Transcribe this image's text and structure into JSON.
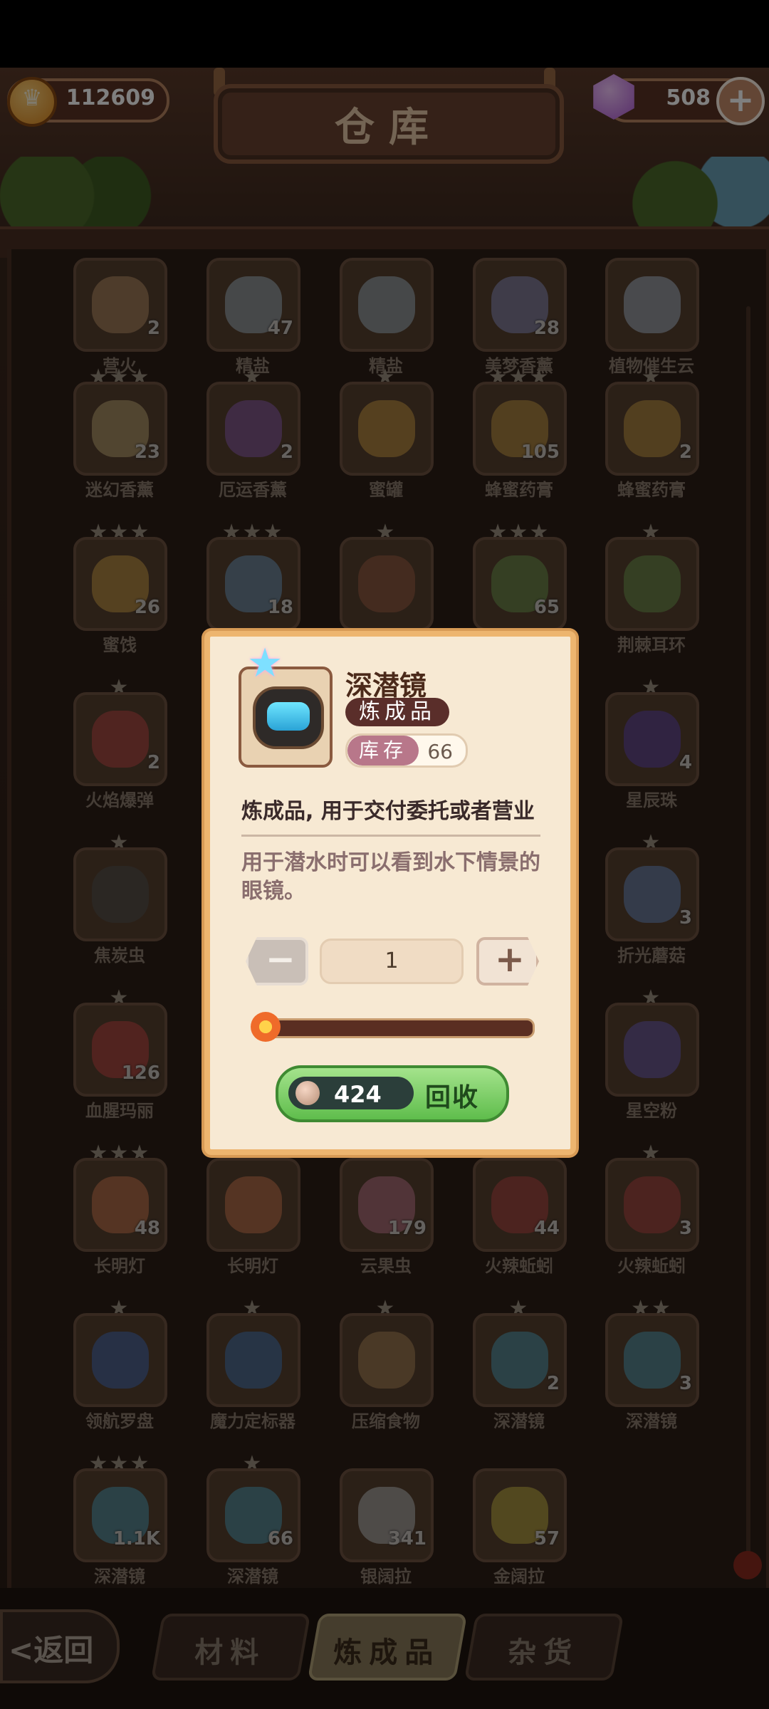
{
  "header": {
    "title": "仓库",
    "coins": "112609",
    "gems": "508"
  },
  "grid": {
    "items": [
      {
        "label": "营火",
        "count": "2",
        "stars": "",
        "color": "#d8a878"
      },
      {
        "label": "精盐",
        "count": "47",
        "stars": "",
        "color": "#bcd2e6"
      },
      {
        "label": "精盐",
        "count": "",
        "stars": "",
        "color": "#bcd2e6"
      },
      {
        "label": "美梦香薰",
        "count": "28",
        "stars": "",
        "color": "#a0a7e6"
      },
      {
        "label": "植物催生云",
        "count": "",
        "stars": "",
        "color": "#c5d9f2"
      },
      {
        "label": "迷幻香薰",
        "count": "23",
        "stars": "★★★",
        "color": "#e2c68a"
      },
      {
        "label": "厄运香薰",
        "count": "2",
        "stars": "★",
        "color": "#a06ad0"
      },
      {
        "label": "蜜罐",
        "count": "",
        "stars": "★",
        "color": "#f0b44a"
      },
      {
        "label": "蜂蜜药膏",
        "count": "105",
        "stars": "★★★",
        "color": "#e8b04a"
      },
      {
        "label": "蜂蜜药膏",
        "count": "2",
        "stars": "★",
        "color": "#e8b04a"
      },
      {
        "label": "蜜饯",
        "count": "26",
        "stars": "★★★",
        "color": "#f0b850"
      },
      {
        "label": "",
        "count": "18",
        "stars": "★★★",
        "color": "#7fb6e6"
      },
      {
        "label": "",
        "count": "",
        "stars": "★",
        "color": "#b56a4a"
      },
      {
        "label": "",
        "count": "65",
        "stars": "★★★",
        "color": "#7cb25a"
      },
      {
        "label": "荆棘耳环",
        "count": "",
        "stars": "★",
        "color": "#7cb25a"
      },
      {
        "label": "火焰爆弹",
        "count": "2",
        "stars": "★",
        "color": "#e05050"
      },
      {
        "label": "",
        "count": "",
        "stars": "",
        "color": "#000000"
      },
      {
        "label": "",
        "count": "",
        "stars": "",
        "color": "#000000"
      },
      {
        "label": "",
        "count": "",
        "stars": "",
        "color": "#000000"
      },
      {
        "label": "星辰珠",
        "count": "4",
        "stars": "★",
        "color": "#6a4ac6"
      },
      {
        "label": "焦炭虫",
        "count": "",
        "stars": "★",
        "color": "#5a5a5a"
      },
      {
        "label": "",
        "count": "",
        "stars": "",
        "color": "#000000"
      },
      {
        "label": "",
        "count": "",
        "stars": "",
        "color": "#000000"
      },
      {
        "label": "",
        "count": "",
        "stars": "",
        "color": "#000000"
      },
      {
        "label": "折光蘑菇",
        "count": "3",
        "stars": "★",
        "color": "#7aa2e8"
      },
      {
        "label": "血腥玛丽",
        "count": "126",
        "stars": "★",
        "color": "#e24a4a"
      },
      {
        "label": "",
        "count": "",
        "stars": "",
        "color": "#000000"
      },
      {
        "label": "",
        "count": "",
        "stars": "",
        "color": "#000000"
      },
      {
        "label": "",
        "count": "",
        "stars": "",
        "color": "#000000"
      },
      {
        "label": "星空粉",
        "count": "",
        "stars": "★",
        "color": "#7a6ad6"
      },
      {
        "label": "长明灯",
        "count": "48",
        "stars": "★★★",
        "color": "#f08a5a"
      },
      {
        "label": "长明灯",
        "count": "",
        "stars": "★",
        "color": "#f08a5a"
      },
      {
        "label": "云果虫",
        "count": "179",
        "stars": "",
        "color": "#e48aa6"
      },
      {
        "label": "火辣蚯蚓",
        "count": "44",
        "stars": "",
        "color": "#d24a4a"
      },
      {
        "label": "火辣蚯蚓",
        "count": "3",
        "stars": "★",
        "color": "#d24a4a"
      },
      {
        "label": "领航罗盘",
        "count": "",
        "stars": "★",
        "color": "#4a7ad6"
      },
      {
        "label": "魔力定标器",
        "count": "",
        "stars": "★",
        "color": "#4a8ad6"
      },
      {
        "label": "压缩食物",
        "count": "",
        "stars": "★",
        "color": "#c89a64"
      },
      {
        "label": "深潜镜",
        "count": "2",
        "stars": "★",
        "color": "#5ab8d8"
      },
      {
        "label": "深潜镜",
        "count": "3",
        "stars": "★★",
        "color": "#5ab8d8"
      },
      {
        "label": "深潜镜",
        "count": "1.1K",
        "stars": "★★★",
        "color": "#5ab8d8"
      },
      {
        "label": "深潜镜",
        "count": "66",
        "stars": "★",
        "color": "#5ab8d8"
      },
      {
        "label": "银阔拉",
        "count": "341",
        "stars": "",
        "color": "#d8dde2"
      },
      {
        "label": "金阔拉",
        "count": "57",
        "stars": "",
        "color": "#e8d24a"
      },
      {
        "label": "",
        "count": "",
        "stars": "",
        "color": "#000000"
      }
    ]
  },
  "popup": {
    "name": "深潜镜",
    "type": "炼成品",
    "stock_label": "库存",
    "stock_value": "66",
    "desc_main": "炼成品, 用于交付委托或者营业",
    "desc_detail": "用于潜水时可以看到水下情景的眼镜。",
    "quantity": "1",
    "slider_level": 0,
    "cost": "424",
    "action_label": "回收"
  },
  "nav": {
    "back_label": "<返回",
    "tabs": [
      "材料",
      "炼成品",
      "杂货"
    ],
    "active_tab": 1
  }
}
